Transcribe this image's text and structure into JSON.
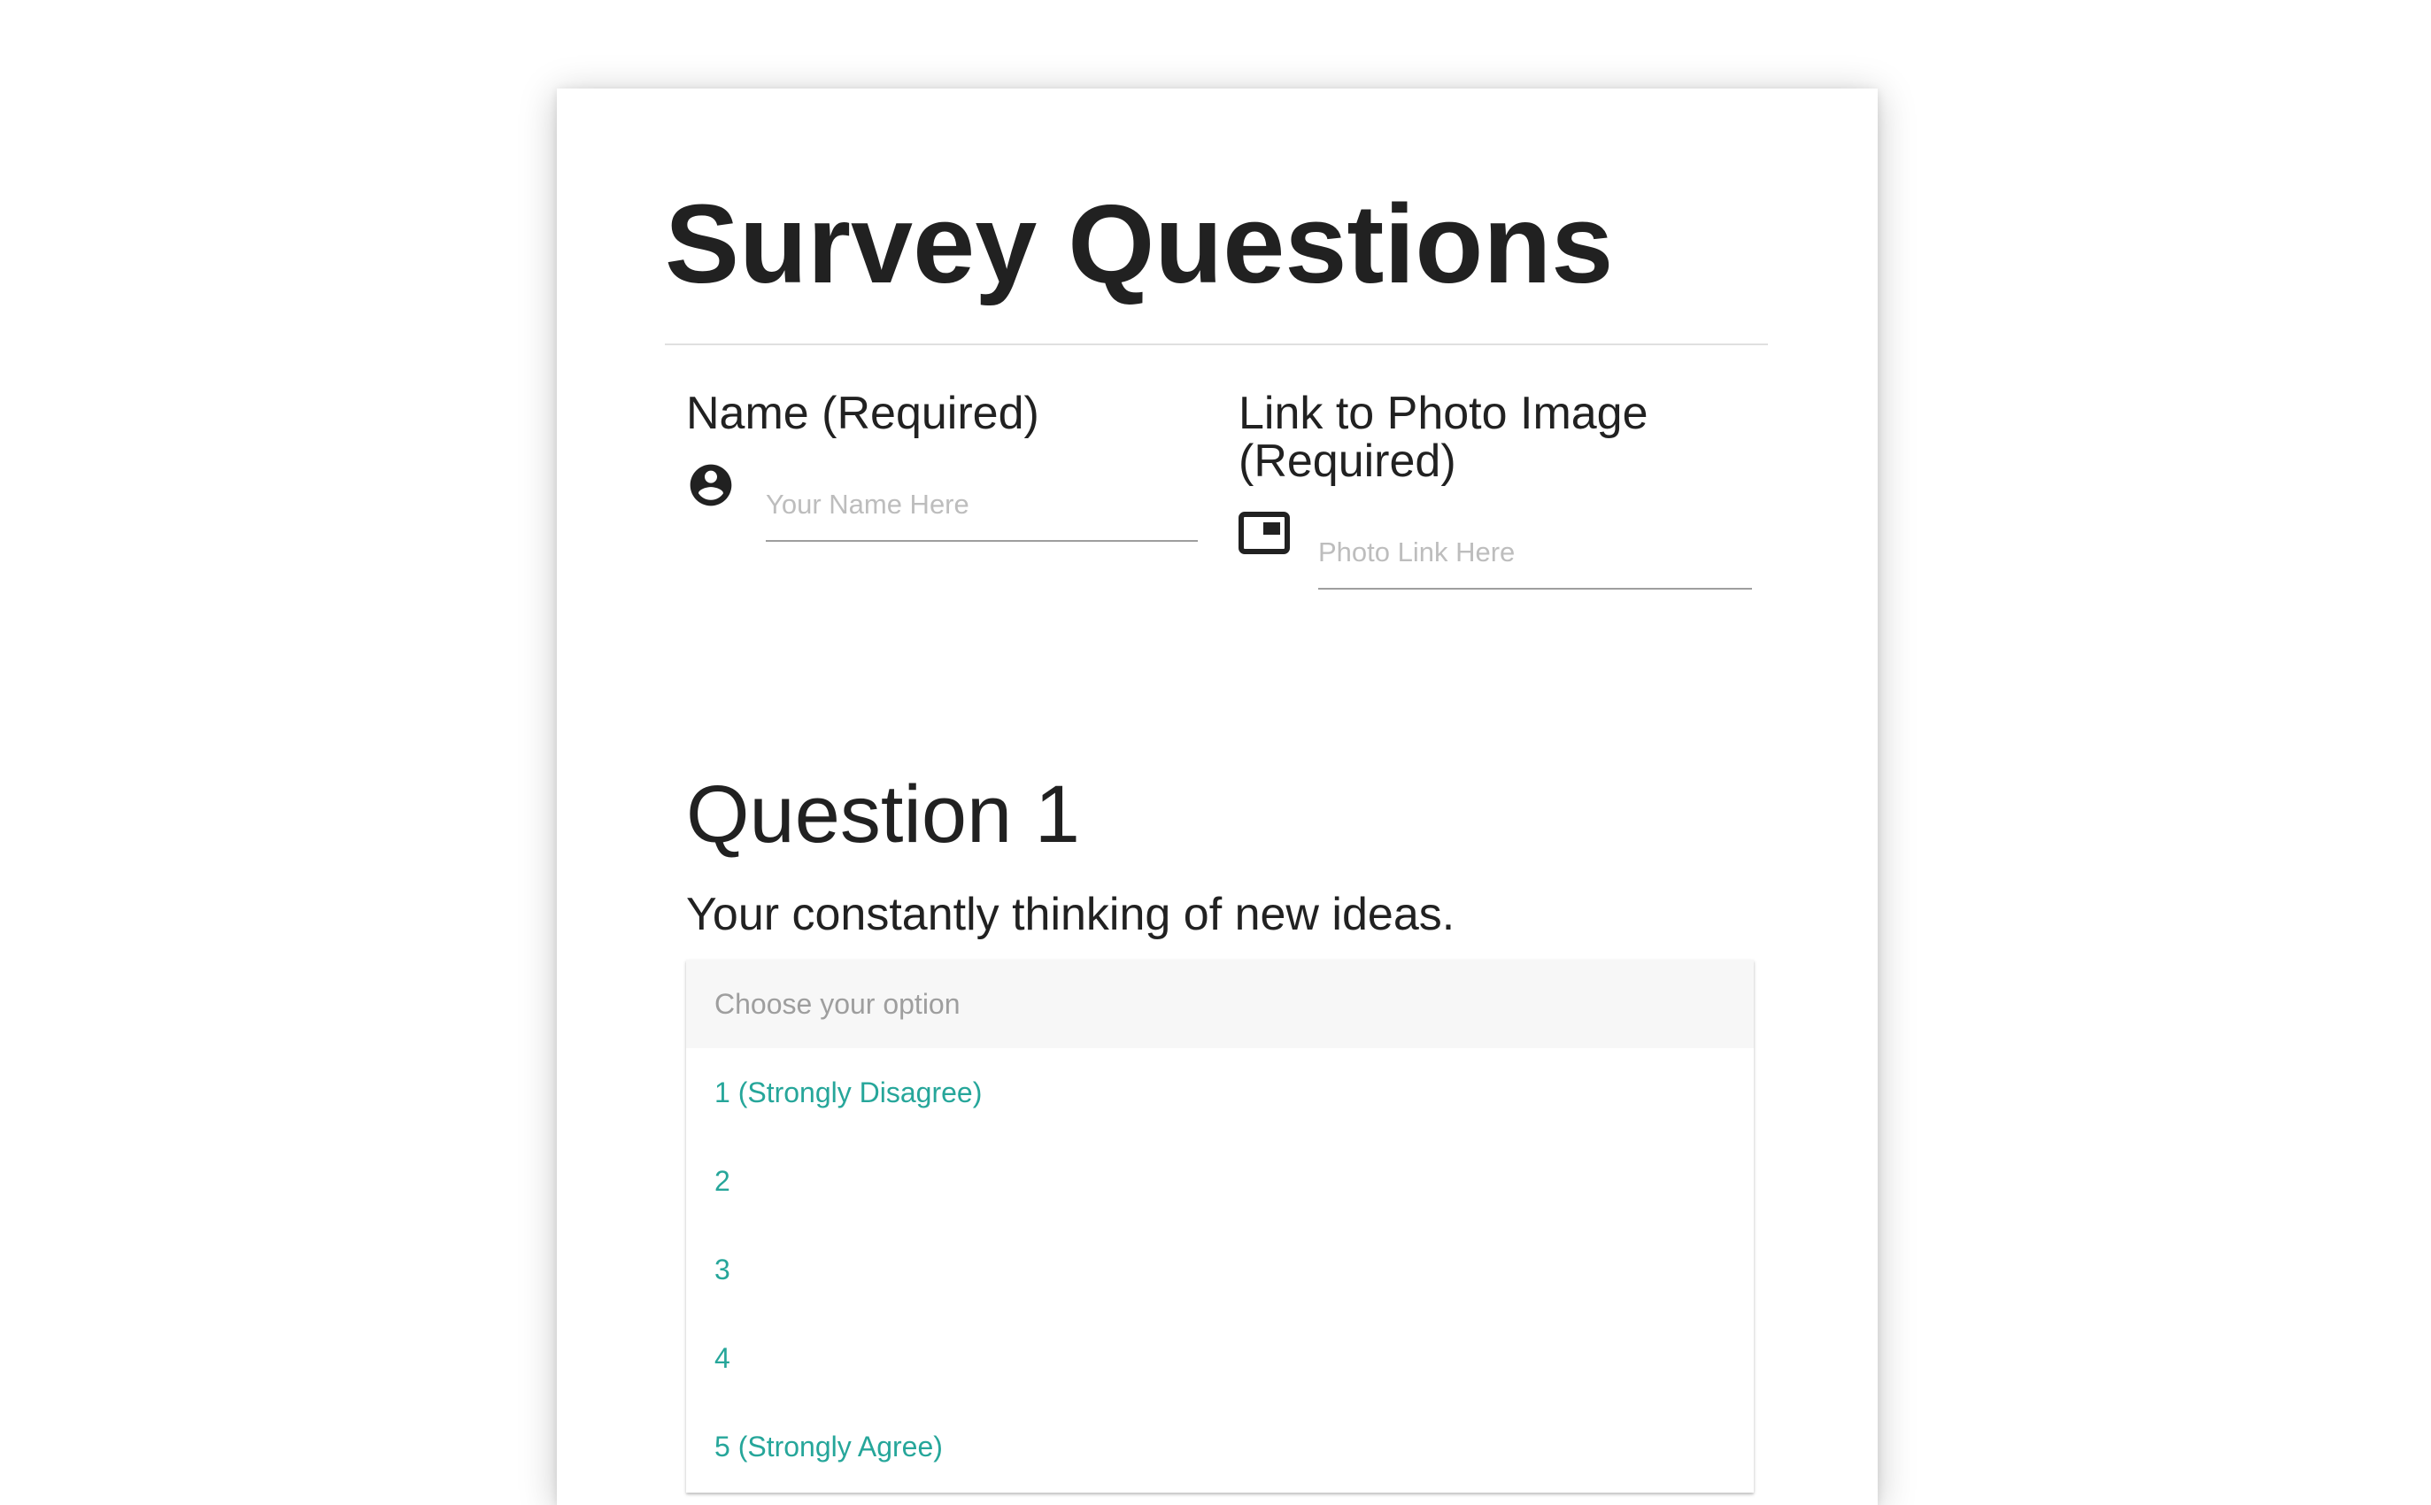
{
  "page": {
    "title": "Survey Questions"
  },
  "fields": {
    "name": {
      "label": "Name (Required)",
      "placeholder": "Your Name Here",
      "value": "",
      "icon": "account-circle-icon"
    },
    "photo": {
      "label": "Link to Photo Image (Required)",
      "placeholder": "Photo Link Here",
      "value": "",
      "icon": "picture-in-picture-icon"
    }
  },
  "question": {
    "heading": "Question 1",
    "text": "Your constantly thinking of new ideas.",
    "select": {
      "placeholder": "Choose your option",
      "options": [
        "1 (Strongly Disagree)",
        "2",
        "3",
        "4",
        "5 (Strongly Agree)"
      ]
    }
  },
  "colors": {
    "text": "#212121",
    "option_accent": "#26a69a",
    "placeholder": "#9e9e9e",
    "input_underline": "#9e9e9e"
  }
}
